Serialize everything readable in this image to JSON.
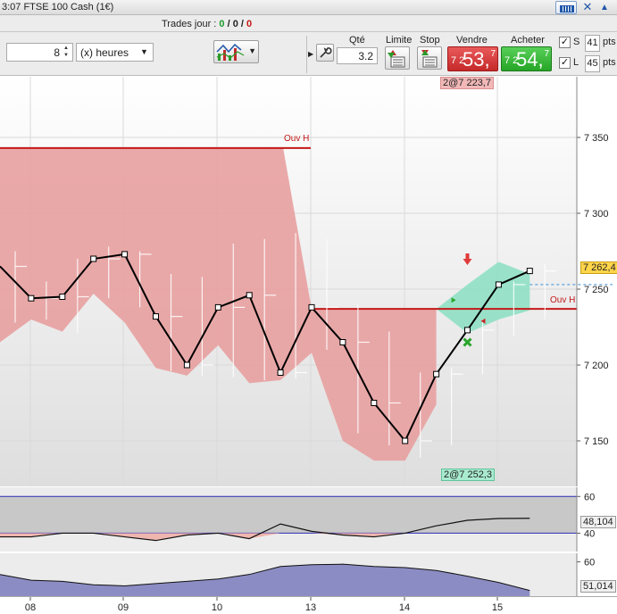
{
  "window": {
    "title": "3:07  FTSE 100 Cash (1€)"
  },
  "trades": {
    "label": "Trades jour : ",
    "won": "0",
    "neutral": "0",
    "lost": "0",
    "sep": "/"
  },
  "toolbar": {
    "period_value": "8",
    "period_unit": "(x) heures",
    "qty_label": "Qté",
    "qty_value": "3.2",
    "limit_label": "Limite",
    "stop_label": "Stop",
    "sell_label": "Vendre",
    "buy_label": "Acheter",
    "sell_price": {
      "prefix": "7 2",
      "big": "53,",
      "sup": "7"
    },
    "buy_price": {
      "prefix": "7 2",
      "big": "54,",
      "sup": "7"
    },
    "stop_s": {
      "label": "S",
      "value": "41",
      "unit": "pts",
      "checked": true
    },
    "stop_l": {
      "label": "L",
      "value": "45",
      "unit": "pts",
      "checked": true
    }
  },
  "chart_annotations": {
    "position_top": "2@7 223,7",
    "position_bottom": "2@7 252,3",
    "open_high_left": "Ouv H",
    "open_high_right": "Ouv H",
    "last_price": "7 262,4",
    "osc_value": "48,104",
    "vol_value": "51,014"
  },
  "colors": {
    "sell_fill": "#e8a0a0",
    "buy_fill": "#8fe0c4",
    "ouv_line": "#c41818",
    "close_line": "#000000",
    "osc_band": "#c8c8c8",
    "vol_fill": "#8c8cc4"
  },
  "chart_data": [
    {
      "type": "line",
      "name": "price",
      "x_labels": [
        "08",
        "09",
        "10",
        "13",
        "14",
        "15"
      ],
      "y_ticks": [
        "7 350",
        "7 300",
        "7 250",
        "7 200",
        "7 150"
      ],
      "ylim": [
        7120,
        7390
      ],
      "close": [
        7265,
        7244,
        7245,
        7270,
        7273,
        7232,
        7200,
        7238,
        7246,
        7195,
        7238,
        7215,
        7175,
        7150,
        7194,
        7223,
        7253,
        7262
      ],
      "high": [
        7275,
        7255,
        7270,
        7278,
        7275,
        7260,
        7258,
        7280,
        7283,
        7287,
        7283,
        7240,
        7222,
        7195,
        7198,
        7230,
        7255,
        7267
      ],
      "low": [
        7228,
        7230,
        7221,
        7244,
        7238,
        7196,
        7193,
        7192,
        7190,
        7191,
        7210,
        7155,
        7147,
        7139,
        7147,
        7194,
        7219,
        7230
      ],
      "ouv_h_left": 7343,
      "ouv_h_right": 7237,
      "sell_band_upper": [
        7343,
        7343,
        7343,
        7343,
        7343,
        7343,
        7343,
        7343,
        7343,
        7343,
        7237,
        7237,
        7237,
        7237,
        7237
      ],
      "sell_band_lower": [
        7215,
        7230,
        7222,
        7247,
        7228,
        7198,
        7193,
        7213,
        7188,
        7190,
        7208,
        7150,
        7137,
        7137,
        7174
      ],
      "buy_band": {
        "start": 14,
        "lower": [
          7237,
          7221,
          7230,
          7236
        ],
        "upper": [
          7237,
          7253,
          7268,
          7260
        ]
      }
    },
    {
      "type": "line",
      "name": "oscillator",
      "y_ticks": [
        "60",
        "40"
      ],
      "ylim": [
        30,
        65
      ],
      "levels": [
        60,
        40
      ],
      "values": [
        38,
        38,
        40,
        40,
        38,
        36,
        39,
        40,
        37,
        45,
        41,
        39,
        38,
        40,
        44,
        47,
        48,
        48.1
      ]
    },
    {
      "type": "area",
      "name": "volume",
      "y_ticks": [
        "60"
      ],
      "ylim": [
        0,
        75
      ],
      "values": [
        38,
        28,
        26,
        20,
        18,
        22,
        26,
        30,
        38,
        52,
        55,
        56,
        52,
        50,
        45,
        35,
        24,
        10
      ]
    }
  ]
}
